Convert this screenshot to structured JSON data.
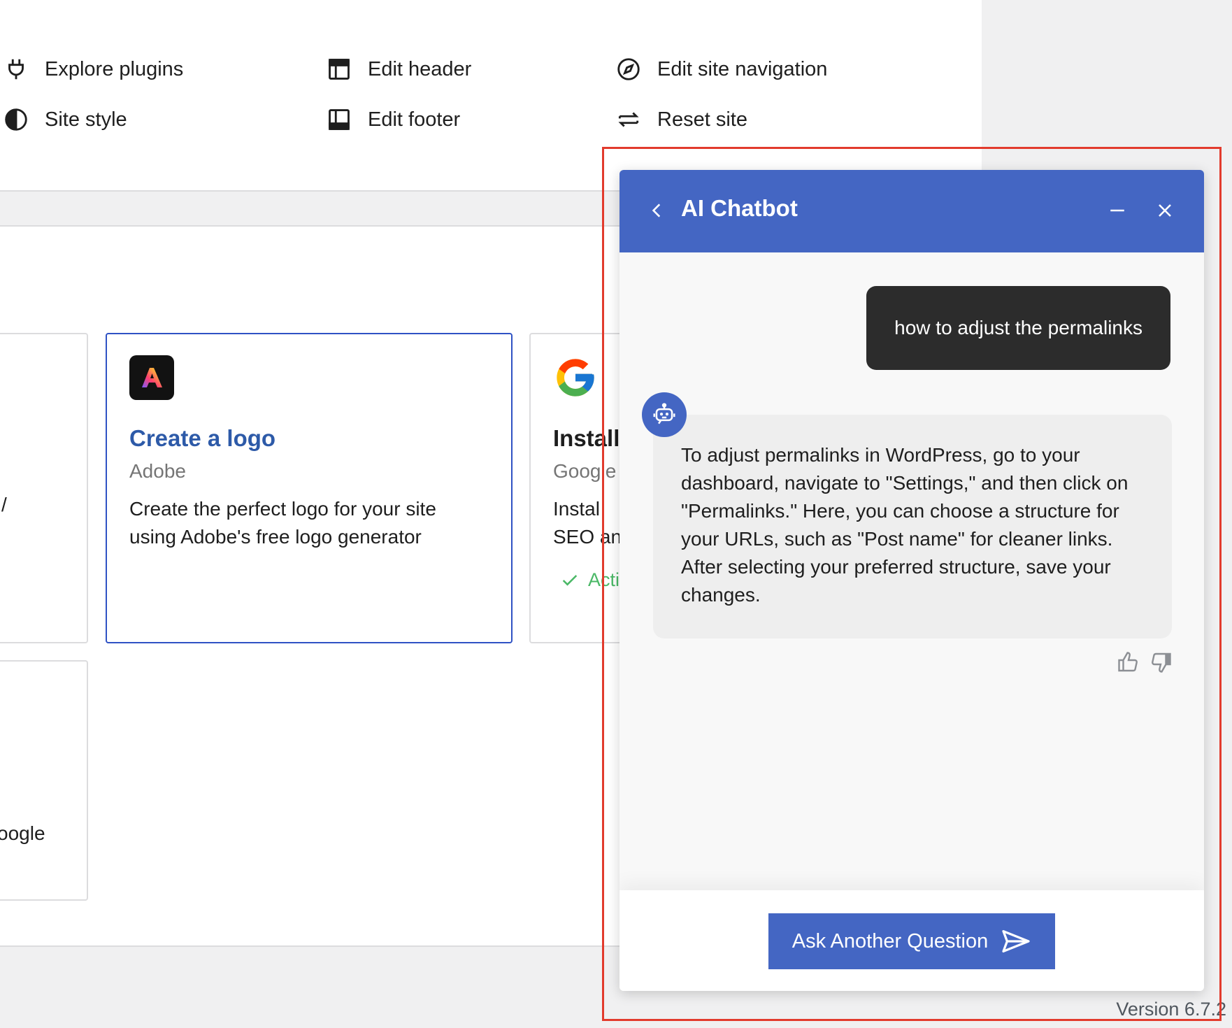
{
  "quick_actions": [
    {
      "label": "Explore plugins",
      "icon": "plug-icon"
    },
    {
      "label": "Edit header",
      "icon": "header-layout-icon"
    },
    {
      "label": "Edit site navigation",
      "icon": "compass-icon"
    },
    {
      "label": "Site style",
      "icon": "half-circle-icon"
    },
    {
      "label": "Edit footer",
      "icon": "footer-layout-icon"
    },
    {
      "label": "Reset site",
      "icon": "reset-arrows-icon"
    }
  ],
  "cards": [
    {
      "title": "Create a logo",
      "vendor": "Adobe",
      "description": "Create the perfect logo for your site using Adobe's free logo generator",
      "icon": "adobe-express-icon"
    },
    {
      "title": "Install",
      "vendor": "Google",
      "description_line1": "Instal",
      "description_line2": "SEO an",
      "status": "Acti",
      "icon": "google-icon"
    }
  ],
  "left_card_fragment": {
    "char": "/",
    "vendor": "oogle"
  },
  "chatbot": {
    "title": "AI Chatbot",
    "user_message": "how to adjust the permalinks",
    "bot_message": "To adjust permalinks in WordPress, go to your dashboard, navigate to \"Settings,\" and then click on \"Permalinks.\" Here, you can choose a structure for your URLs, such as \"Post name\" for cleaner links. After selecting your preferred structure, save your changes.",
    "ask_button": "Ask Another Question"
  },
  "version": "Version 6.7.2",
  "colors": {
    "accent": "#4466c3",
    "highlight": "#e23b2d",
    "user_bubble": "#2c2c2c",
    "link": "#2d5aa8",
    "success": "#4ab866"
  }
}
